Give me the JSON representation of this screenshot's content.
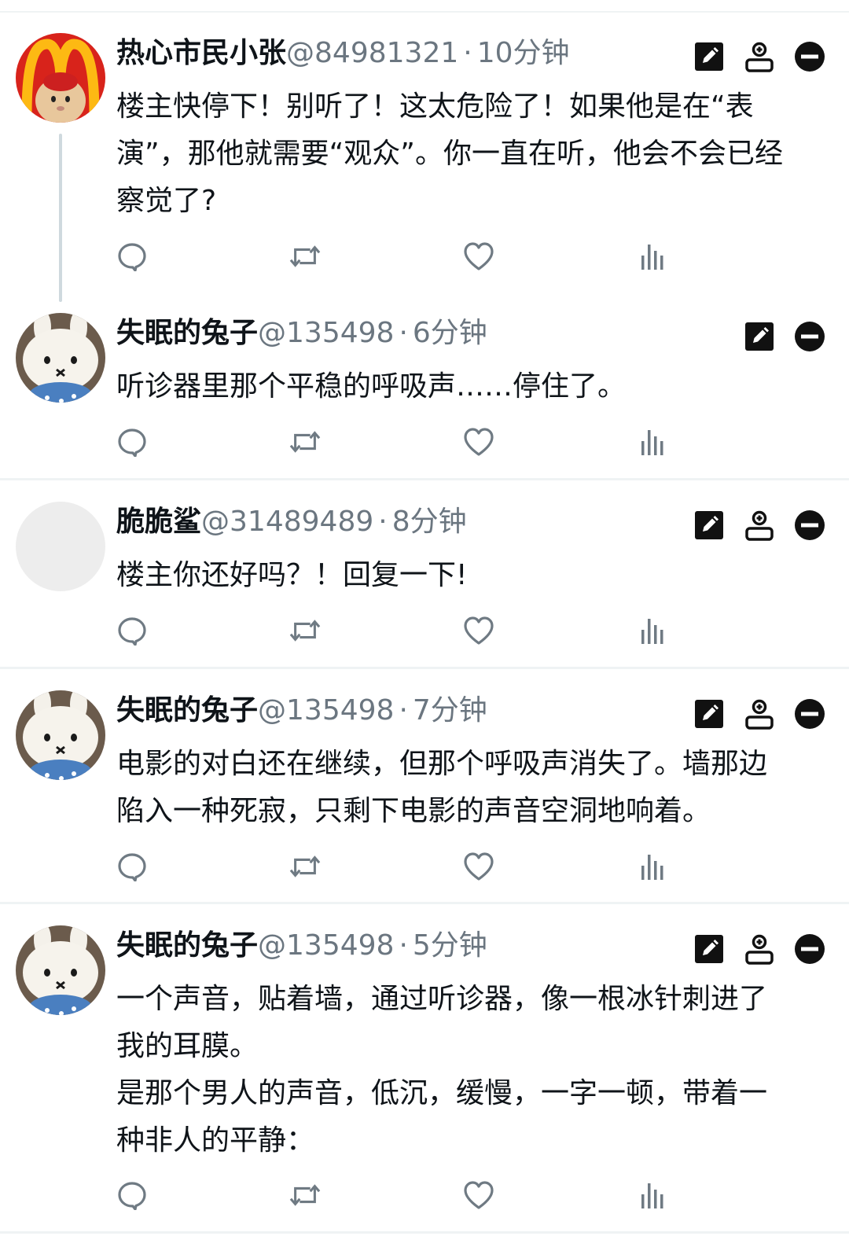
{
  "posts": [
    {
      "name": "热心市民小张",
      "handle": "@84981321",
      "separator": "·",
      "time": "10分钟",
      "text": "楼主快停下！别听了！这太危险了！如果他是在“表\n演”，那他就需要“观众”。你一直在听，他会不会已经\n察觉了?",
      "avatar": "mcdonalds-hamster-avatar"
    },
    {
      "name": "失眠的兔子",
      "handle": "@135498",
      "separator": "·",
      "time": "6分钟",
      "text": "听诊器里那个平稳的呼吸声……停住了。",
      "avatar": "plush-bunny-avatar"
    },
    {
      "name": "脆脆鲨",
      "handle": "@31489489",
      "separator": "·",
      "time": "8分钟",
      "text": "楼主你还好吗？！回复一下!",
      "avatar": "blank-gray-avatar"
    },
    {
      "name": "失眠的兔子",
      "handle": "@135498",
      "separator": "·",
      "time": "7分钟",
      "text": "电影的对白还在继续，但那个呼吸声消失了。墙那边\n陷入一种死寂，只剩下电影的声音空洞地响着。",
      "avatar": "plush-bunny-avatar"
    },
    {
      "name": "失眠的兔子",
      "handle": "@135498",
      "separator": "·",
      "time": "5分钟",
      "text": "一个声音，贴着墙，通过听诊器，像一根冰针刺进了\n我的耳膜。\n是那个男人的声音，低沉，缓慢，一字一顿，带着一\n种非人的平静：",
      "avatar": "plush-bunny-avatar"
    }
  ],
  "icons": {
    "edit": "edit-icon",
    "follow": "add-user-icon",
    "block": "minus-circle-icon",
    "reply": "reply-icon",
    "repost": "repost-icon",
    "like": "heart-icon",
    "views": "views-icon"
  },
  "colors": {
    "text": "#0f1419",
    "secondary": "#6b7680",
    "separator": "#eff3f4",
    "thread_line": "#cfd9de",
    "action_icon": "#6f7a83",
    "mcdonalds_red": "#d8231b",
    "mcdonalds_yellow": "#fdb913"
  }
}
